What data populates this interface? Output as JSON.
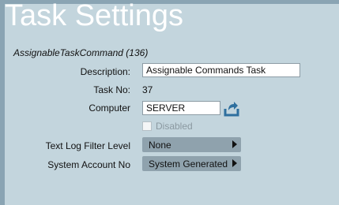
{
  "header": {
    "title": "Task Settings"
  },
  "command": {
    "class_label": "AssignableTaskCommand (136)"
  },
  "fields": {
    "description": {
      "label": "Description:",
      "value": "Assignable Commands Task"
    },
    "task_no": {
      "label": "Task No:",
      "value": "37"
    },
    "computer": {
      "label": "Computer",
      "value": "SERVER",
      "icon": "export-icon"
    },
    "disabled": {
      "label": "Disabled",
      "checked": false
    },
    "text_log_filter_level": {
      "label": "Text Log Filter Level",
      "value": "None"
    },
    "system_account_no": {
      "label": "System Account No",
      "value": "System Generated"
    }
  },
  "colors": {
    "background": "#c3d5dd",
    "dropdown": "#8fa2ad",
    "icon": "#2e6f9e"
  }
}
